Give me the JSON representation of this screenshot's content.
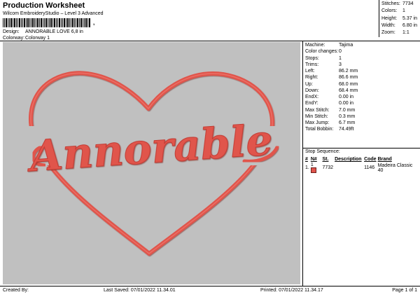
{
  "header": {
    "title": "Production Worksheet",
    "subtitle": "Wilcom EmbroideryStudio – Level 3 Advanced",
    "barcode_suffix": ","
  },
  "info": {
    "design_label": "Design:",
    "design_value": "ANNORABLE LOVE 6,8 in",
    "colorway_label": "Colorway:",
    "colorway_value": "Colorway 1"
  },
  "summary": [
    {
      "label": "Stitches:",
      "value": "7734"
    },
    {
      "label": "Colors:",
      "value": "1"
    },
    {
      "label": "Height:",
      "value": "5.37 in"
    },
    {
      "label": "Width:",
      "value": "6.80 in"
    },
    {
      "label": "Zoom:",
      "value": "1:1"
    }
  ],
  "design_preview": {
    "text": "Annorable",
    "colors": {
      "thread": "#e0544c",
      "thread_dark": "#c23a33",
      "background": "#c0c0c0"
    }
  },
  "stats": [
    {
      "label": "Machine:",
      "value": "Tajima"
    },
    {
      "label": "Color changes:",
      "value": "0"
    },
    {
      "label": "Stops:",
      "value": "1"
    },
    {
      "label": "Trims:",
      "value": "3"
    },
    {
      "label": "Left:",
      "value": "86.2 mm"
    },
    {
      "label": "Right:",
      "value": "86.6 mm"
    },
    {
      "label": "Up:",
      "value": "68.0 mm"
    },
    {
      "label": "Down:",
      "value": "68.4 mm"
    },
    {
      "label": "EndX:",
      "value": "0.00 in"
    },
    {
      "label": "EndY:",
      "value": "0.00 in"
    },
    {
      "label": "Max Stitch:",
      "value": "7.0 mm"
    },
    {
      "label": "Min Stitch:",
      "value": "0.3 mm"
    },
    {
      "label": "Max Jump:",
      "value": "6.7 mm"
    },
    {
      "label": "Total Bobbin:",
      "value": "74.49ft"
    }
  ],
  "stop_sequence": {
    "title": "Stop Sequence:",
    "headers": [
      "#",
      "N#",
      "St.",
      "Description",
      "Code",
      "Brand"
    ],
    "rows": [
      {
        "num": "1.",
        "n": "1",
        "st": "7732",
        "description": "",
        "code": "1146",
        "brand": "Madeira Classic 40"
      }
    ]
  },
  "footer": {
    "created_by": "Created By:",
    "last_saved": "Last Saved: 07/01/2022 11.34.01",
    "printed": "Printed: 07/01/2022 11.34.17",
    "page": "Page 1 of 1"
  }
}
